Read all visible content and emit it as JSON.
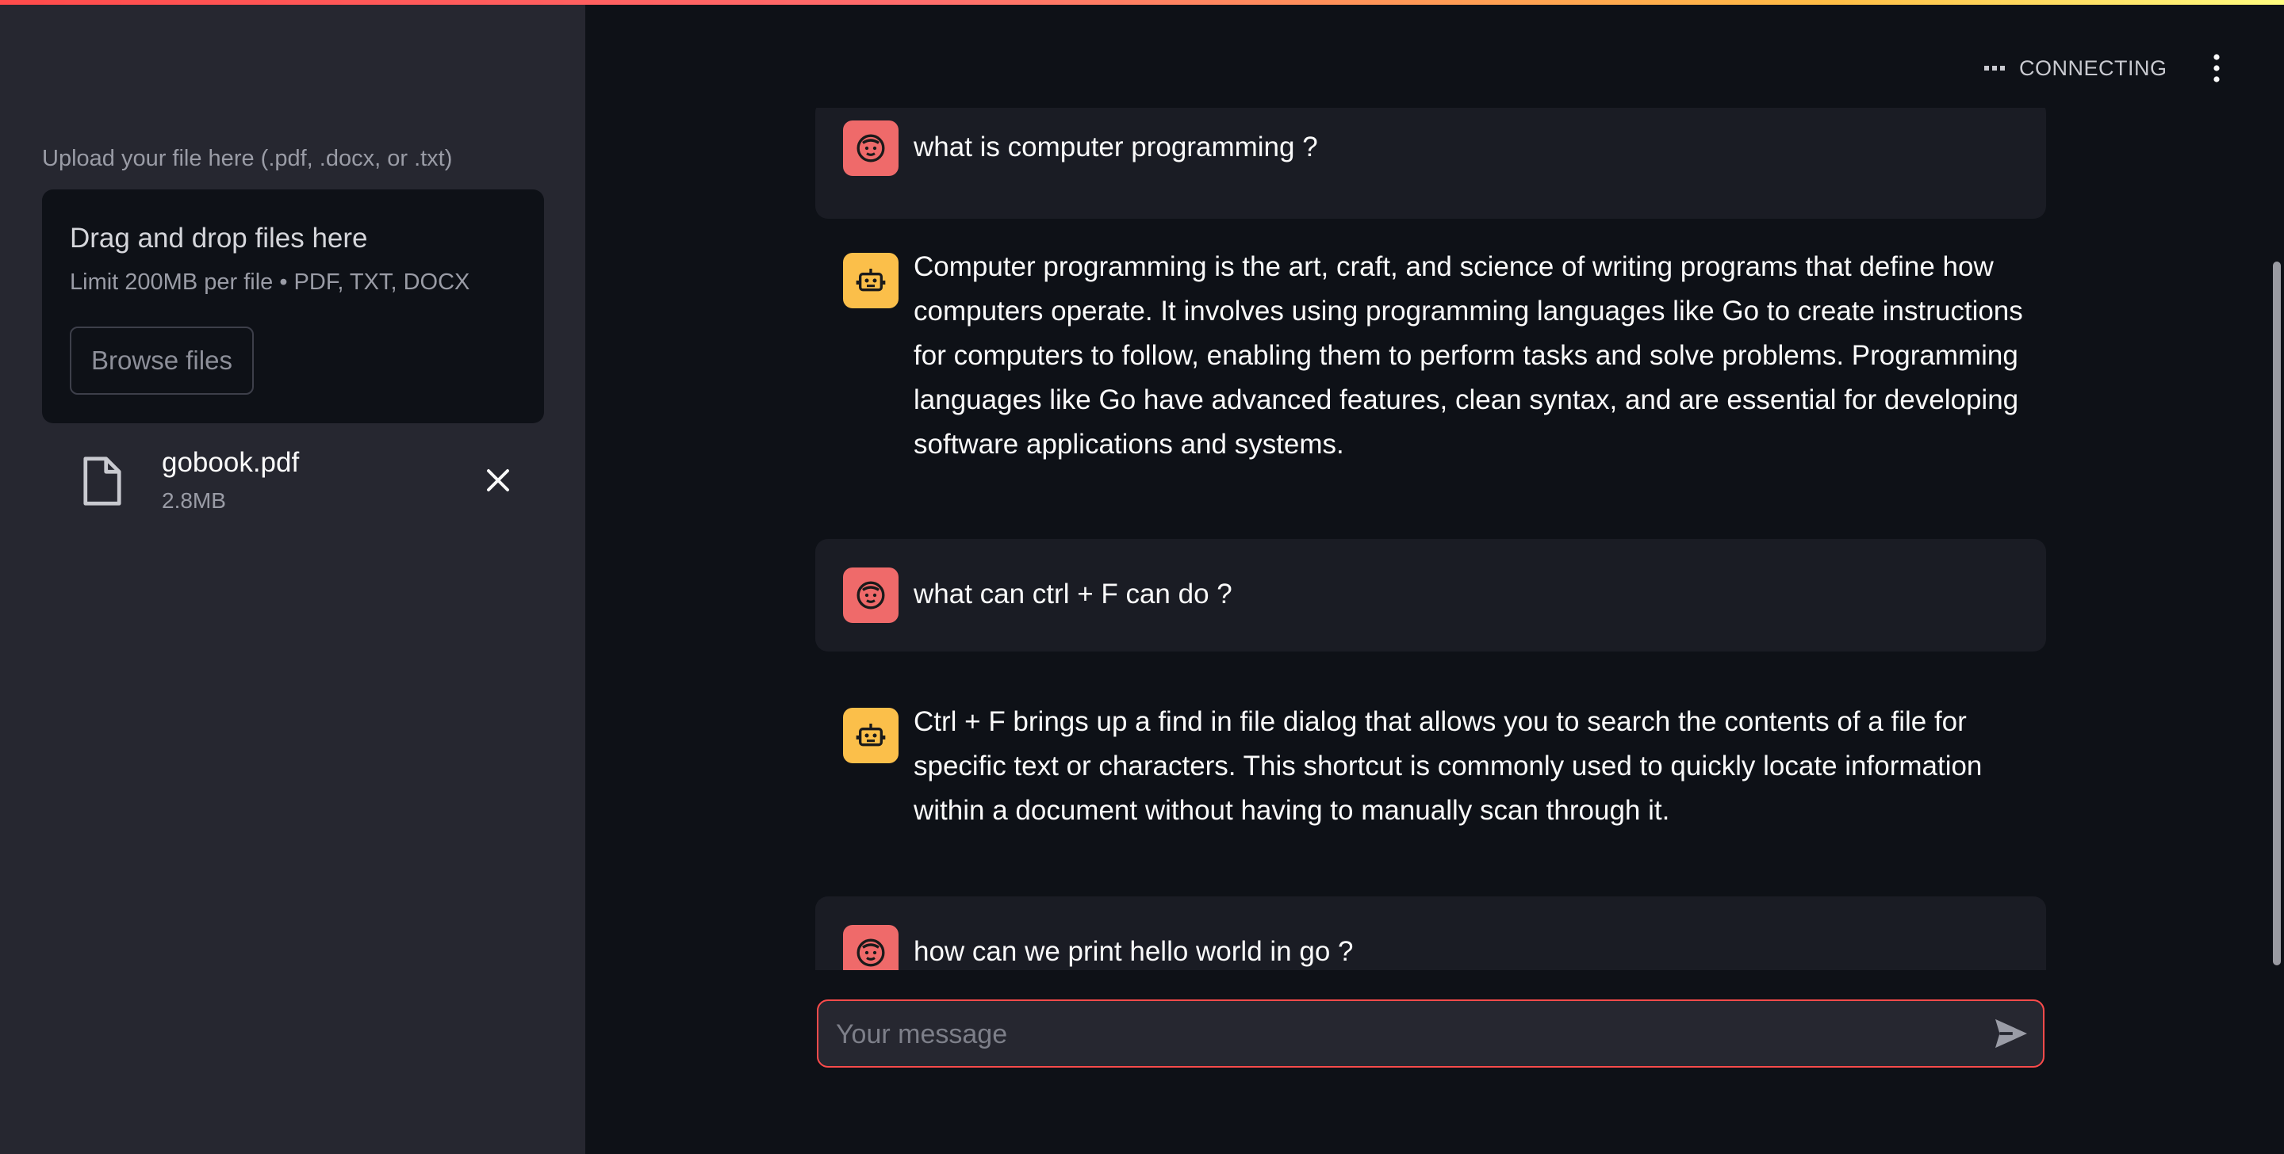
{
  "sidebar": {
    "upload_label": "Upload your file here (.pdf, .docx, or .txt)",
    "dropzone_title": "Drag and drop files here",
    "dropzone_limit": "Limit 200MB per file • PDF, TXT, DOCX",
    "browse_label": "Browse files",
    "file": {
      "name": "gobook.pdf",
      "size": "2.8MB"
    }
  },
  "header": {
    "status": "CONNECTING"
  },
  "chat": {
    "messages": [
      {
        "role": "user",
        "text": "what is computer programming ?"
      },
      {
        "role": "assistant",
        "text": "Computer programming is the art, craft, and science of writing programs that define how computers operate. It involves using programming languages like Go to create instructions for computers to follow, enabling them to perform tasks and solve problems. Programming languages like Go have advanced features, clean syntax, and are essential for developing software applications and systems."
      },
      {
        "role": "user",
        "text": "what can ctrl + F can do ?"
      },
      {
        "role": "assistant",
        "text": "Ctrl + F brings up a find in file dialog that allows you to search the contents of a file for specific text or characters. This shortcut is commonly used to quickly locate information within a document without having to manually scan through it."
      },
      {
        "role": "user",
        "text": "how can we print hello world in go ?"
      }
    ]
  },
  "input": {
    "placeholder": "Your message"
  },
  "colors": {
    "accent": "#ff4b4b",
    "user_avatar": "#ef6a6a",
    "bot_avatar": "#fbbf4a"
  }
}
